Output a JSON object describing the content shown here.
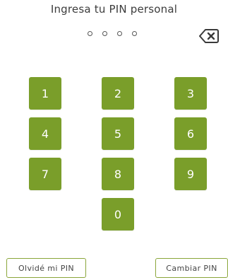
{
  "header": {
    "title": "Ingresa tu PIN personal",
    "pin_length": 4,
    "pin_entered": 0
  },
  "keypad": {
    "keys": [
      "1",
      "2",
      "3",
      "4",
      "5",
      "6",
      "7",
      "8",
      "9",
      "0"
    ],
    "backspace_icon": "backspace-icon"
  },
  "actions": {
    "forgot_label": "Olvidé mi PIN",
    "change_label": "Cambiar PIN"
  },
  "colors": {
    "key_background": "#7a9e2a",
    "key_text": "#ffffff",
    "button_border": "#8aa63a"
  }
}
